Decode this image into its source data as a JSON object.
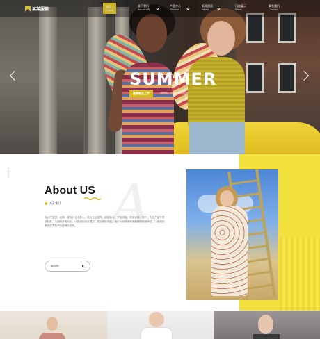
{
  "nav": {
    "logo_text": "某某服装",
    "items": [
      {
        "cn": "首页",
        "en": "Home"
      },
      {
        "cn": "关于我们",
        "en": "About US"
      },
      {
        "cn": "产品中心",
        "en": "Product"
      },
      {
        "cn": "新闻资讯",
        "en": "News"
      },
      {
        "cn": "门店展示",
        "en": "Store"
      },
      {
        "cn": "联系我们",
        "en": "Contact"
      }
    ]
  },
  "hero": {
    "headline": "SUMMER",
    "tag": "夏季新品上市",
    "sub": "Spring / Summer 2018"
  },
  "side_label": "About us",
  "about": {
    "watermark": "A",
    "title": "About US",
    "subtitle": "关于我们",
    "body": "特以打造国、品牌、服务为企业核心，崇尚企业精神，团结奋斗，开拓进取，务实创新。特产、专业产品开发团队集，以面料开发为主，以先进的设计理念、高品质的产品，为广大消费者带来新鲜的时尚体验，以优质的服务赢得客户的信赖与支持。",
    "more_label": "MORE"
  },
  "colors": {
    "accent": "#d6bd1e",
    "yellow_block": "#f3e23d"
  }
}
